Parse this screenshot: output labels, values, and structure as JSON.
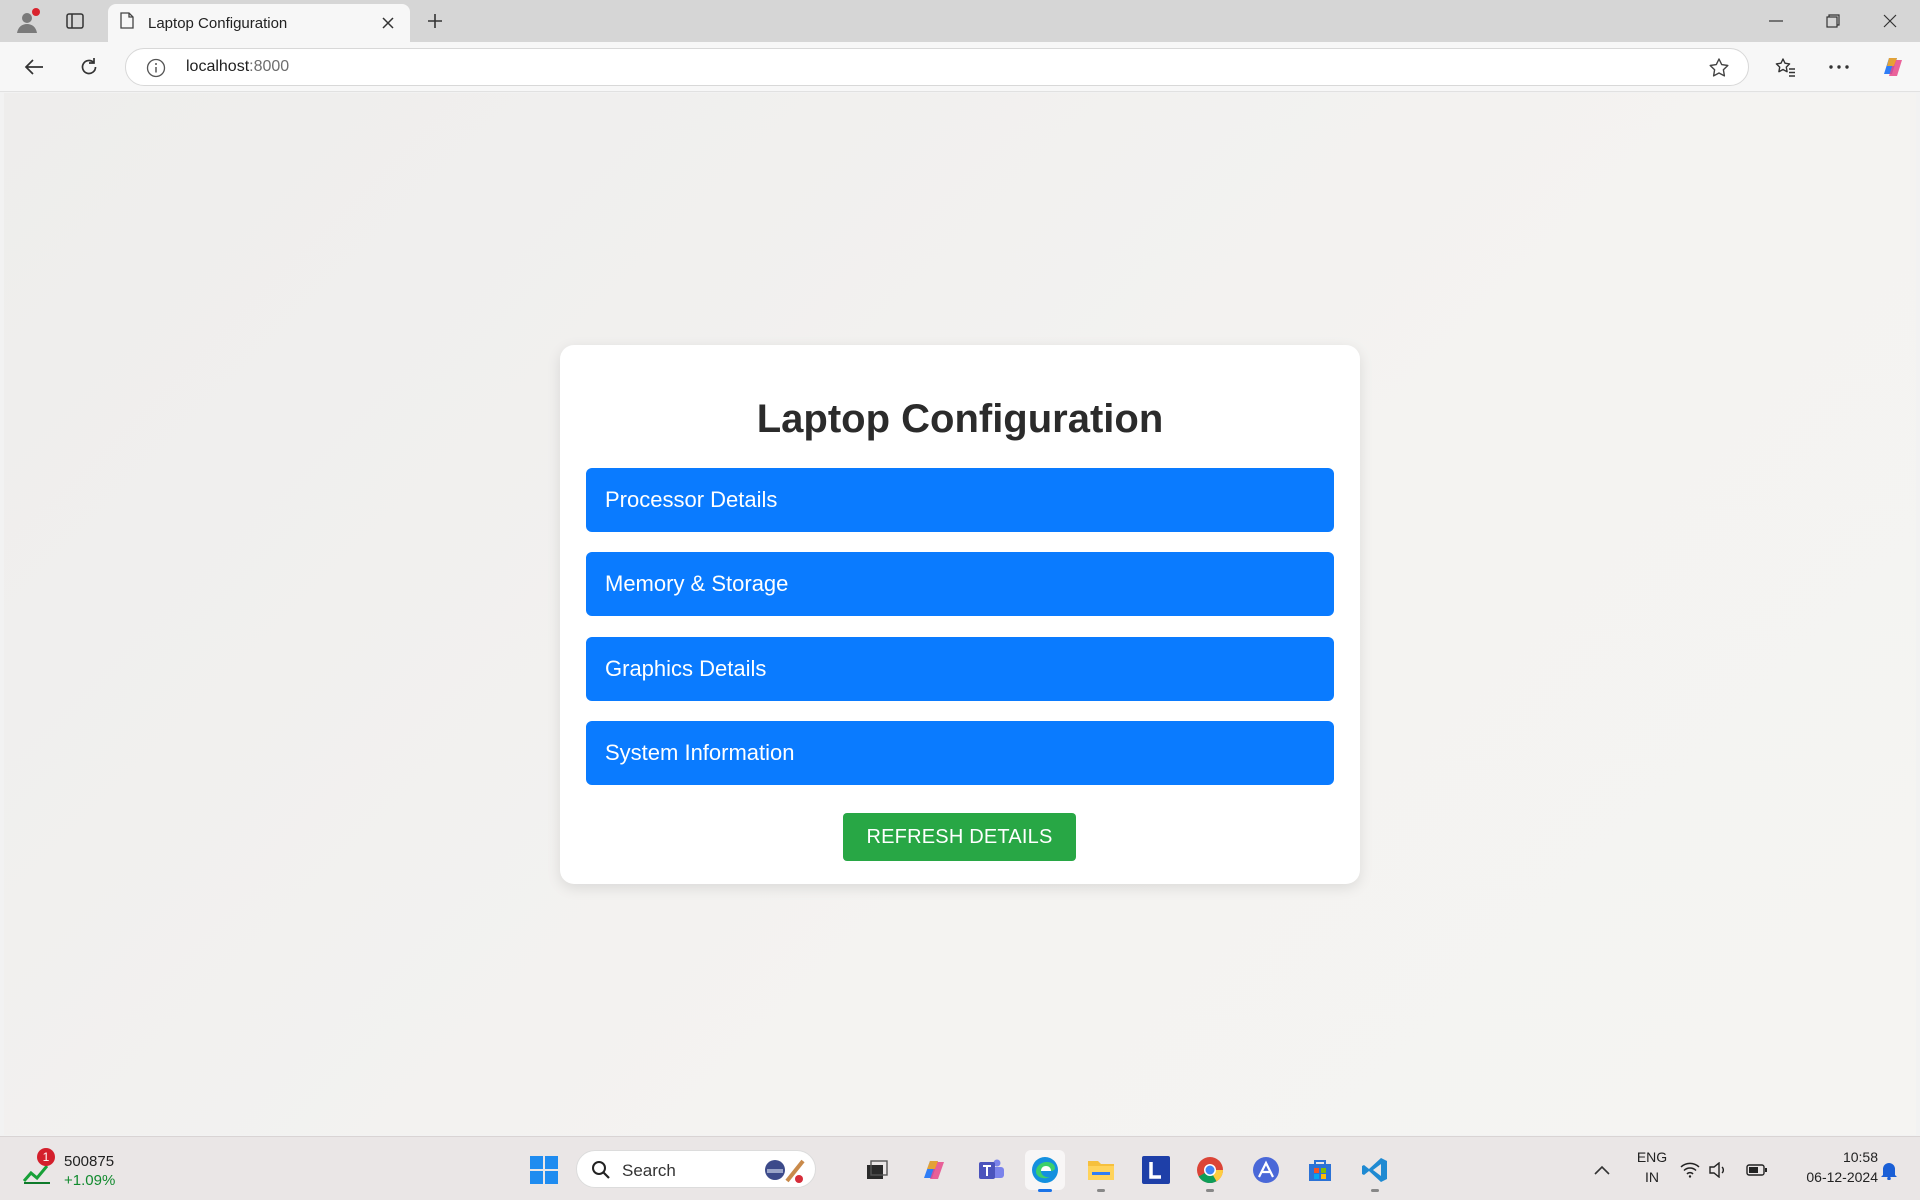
{
  "browser": {
    "tab_title": "Laptop Configuration",
    "url_host": "localhost",
    "url_port": ":8000"
  },
  "page": {
    "heading": "Laptop Configuration",
    "sections": [
      {
        "label": "Processor Details"
      },
      {
        "label": "Memory & Storage"
      },
      {
        "label": "Graphics Details"
      },
      {
        "label": "System Information"
      }
    ],
    "refresh_label": "REFRESH DETAILS",
    "colors": {
      "section_button": "#0a7bff",
      "refresh_button": "#28a745"
    }
  },
  "taskbar": {
    "stock_badge": "1",
    "stock_value": "500875",
    "stock_change": "+1.09%",
    "search_placeholder": "Search",
    "lang_line1": "ENG",
    "lang_line2": "IN",
    "time": "10:58",
    "date": "06-12-2024"
  }
}
